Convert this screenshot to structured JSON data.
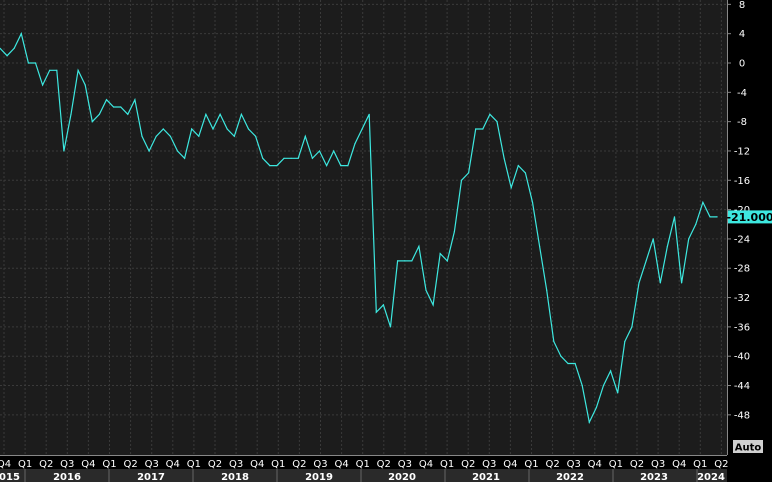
{
  "chart_data": {
    "type": "line",
    "title": "",
    "xlabel": "",
    "ylabel": "",
    "ylim": [
      -52,
      8
    ],
    "y_ticks": [
      8,
      4,
      0,
      -4,
      -8,
      -12,
      -16,
      -20,
      -24,
      -28,
      -32,
      -36,
      -40,
      -44,
      -48
    ],
    "grid": true,
    "legend": "none",
    "colors": {
      "background": "#000000",
      "plot_background": "#1c1c1c",
      "grid": "#3a3a3a",
      "line": "#3de8e0",
      "axis_text": "#ffffff",
      "year_band": "#2a2a2a",
      "button": "#d0d0d0"
    },
    "last_value_label": "-21.000",
    "auto_button_label": "Auto",
    "quarter_ticks": [
      "Q4",
      "Q1",
      "Q2",
      "Q3",
      "Q4",
      "Q1",
      "Q2",
      "Q3",
      "Q4",
      "Q1",
      "Q2",
      "Q3",
      "Q4",
      "Q1",
      "Q2",
      "Q3",
      "Q4",
      "Q1",
      "Q2",
      "Q3",
      "Q4",
      "Q1",
      "Q2",
      "Q3",
      "Q4",
      "Q1",
      "Q2",
      "Q3",
      "Q4",
      "Q1",
      "Q2",
      "Q3",
      "Q4",
      "Q1",
      "Q2"
    ],
    "year_labels": [
      "2015",
      "2016",
      "2017",
      "2018",
      "2019",
      "2020",
      "2021",
      "2022",
      "2023",
      "2024"
    ],
    "series": [
      {
        "values": [
          2,
          1,
          2,
          4,
          0,
          0,
          -3,
          -1,
          -1,
          -12,
          -7,
          -1,
          -3,
          -8,
          -7,
          -5,
          -6,
          -6,
          -7,
          -5,
          -10,
          -12,
          -10,
          -9,
          -10,
          -12,
          -13,
          -9,
          -10,
          -7,
          -9,
          -7,
          -9,
          -10,
          -7,
          -9,
          -10,
          -13,
          -14,
          -14,
          -13,
          -13,
          -13,
          -10,
          -13,
          -12,
          -14,
          -12,
          -14,
          -14,
          -11,
          -9,
          -7,
          -34,
          -33,
          -36,
          -27,
          -27,
          -27,
          -25,
          -31,
          -33,
          -26,
          -27,
          -23,
          -16,
          -15,
          -9,
          -9,
          -7,
          -8,
          -13,
          -17,
          -14,
          -15,
          -19,
          -25,
          -31,
          -38,
          -40,
          -41,
          -41,
          -44,
          -49,
          -47,
          -44,
          -42,
          -45,
          -38,
          -36,
          -30,
          -27,
          -24,
          -30,
          -25,
          -21,
          -30,
          -24,
          -22,
          -19,
          -21,
          -21
        ]
      }
    ]
  }
}
